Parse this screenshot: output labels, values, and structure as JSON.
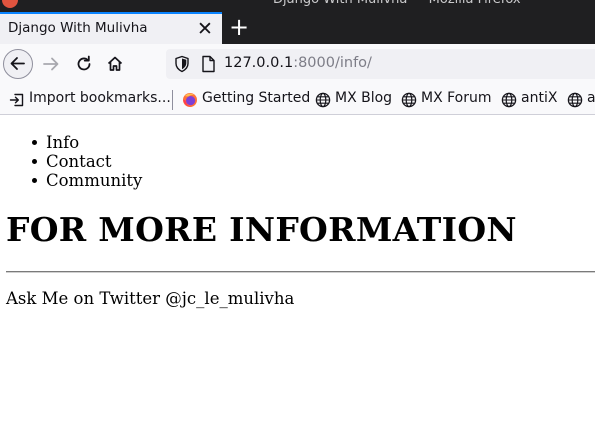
{
  "window": {
    "title": "Django With Mulivha — Mozilla Firefox"
  },
  "tab": {
    "title": "Django With Mulivha",
    "close_glyph": "✕"
  },
  "newtab": {
    "glyph": "+"
  },
  "urlbar": {
    "host": "127.0.0.1",
    "path": ":8000/info/"
  },
  "bookmarks": {
    "items": [
      {
        "label": "Import bookmarks...",
        "icon": "import-icon"
      },
      {
        "label": "Getting Started",
        "icon": "firefox-icon"
      },
      {
        "label": "MX Blog",
        "icon": "globe-icon"
      },
      {
        "label": "MX Forum",
        "icon": "globe-icon"
      },
      {
        "label": "antiX",
        "icon": "globe-icon"
      },
      {
        "label": "a",
        "icon": "globe-icon"
      }
    ]
  },
  "page": {
    "nav_links": [
      "Info",
      "Contact",
      "Community"
    ],
    "heading": "FOR MORE INFORMATION",
    "footer": "Ask Me on Twitter @jc_le_mulivha"
  },
  "colors": {
    "accent": "#0a84ff",
    "dark_chrome": "#1f1f21",
    "toolbar": "#f9f9fb",
    "tab_bg": "#f0f0f4"
  }
}
